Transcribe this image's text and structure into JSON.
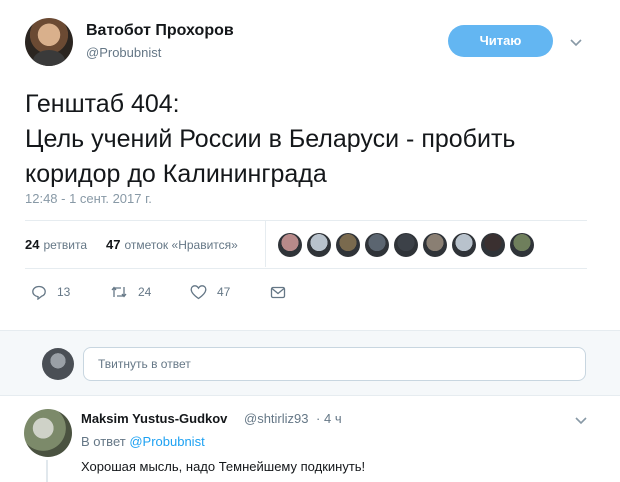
{
  "tweet": {
    "author_name": "Ватобот Прохоров",
    "author_handle": "@Probubnist",
    "follow_label": "Читаю",
    "text_lines": [
      "Генштаб 404:",
      "Цель учений России в Беларуси - пробить",
      "коридор до Калининграда"
    ],
    "timestamp": "12:48 - 1 сент. 2017 г.",
    "retweets_count": "24",
    "retweets_label": "ретвита",
    "likes_count": "47",
    "likes_label": "отметок «Нравится»",
    "liker_avatar_colors": [
      "#b88a8a",
      "#b8c2cc",
      "#7a6a4e",
      "#5b6570",
      "#3c4148",
      "#8a7f73",
      "#b8c2cc",
      "#3a3030",
      "#6f7f5c"
    ],
    "actions": {
      "reply_count": "13",
      "retweet_count": "24",
      "like_count": "47"
    }
  },
  "reply_box": {
    "placeholder": "Твитнуть в ответ"
  },
  "reply": {
    "author_name": "Maksim Yustus-Gudkov",
    "author_handle": "@shtirliz93",
    "dot": "·",
    "time": "4 ч",
    "in_reply_prefix": "В ответ",
    "in_reply_handle": "@Probubnist",
    "text": "Хорошая мысль, надо Темнейшему подкинуть!"
  },
  "colors": {
    "accent": "#1da1f2",
    "follow_button": "#63b6f2",
    "muted_text": "#657786"
  },
  "icons": [
    "chevron-down-icon",
    "reply-icon",
    "retweet-icon",
    "heart-icon",
    "direct-message-icon"
  ]
}
